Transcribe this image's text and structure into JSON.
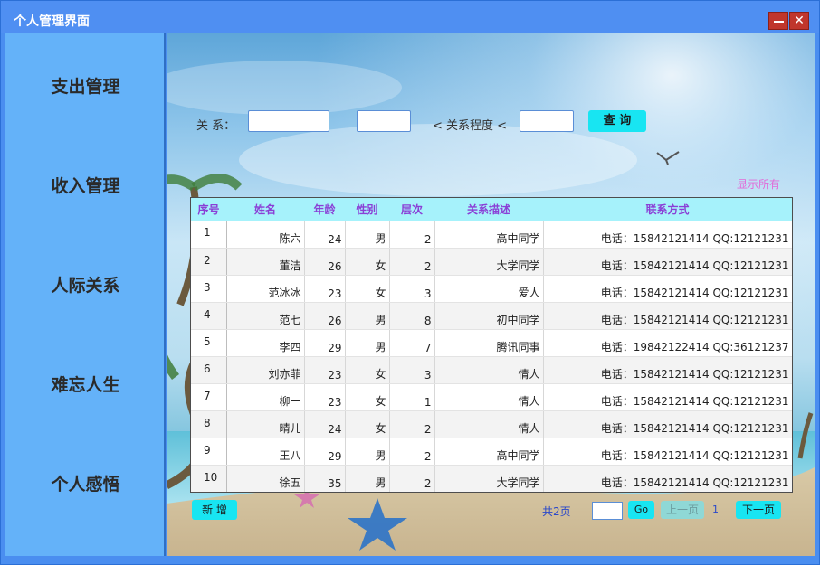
{
  "window": {
    "title": "个人管理界面",
    "minimize_label": "—",
    "close_label": "✕"
  },
  "sidebar": {
    "items": [
      {
        "label": "支出管理"
      },
      {
        "label": "收入管理"
      },
      {
        "label": "人际关系"
      },
      {
        "label": "难忘人生"
      },
      {
        "label": "个人感悟"
      }
    ]
  },
  "search": {
    "relation_label": "关 系：",
    "relation_value": "",
    "second_value": "",
    "degree_label": "< 关系程度 <",
    "degree_value": "",
    "query_label": "查 询",
    "show_all_label": "显示所有"
  },
  "table": {
    "columns": [
      "序号",
      "姓名",
      "年龄",
      "性别",
      "层次",
      "关系描述",
      "联系方式"
    ],
    "rows": [
      [
        "1",
        "陈六",
        "24",
        "男",
        "2",
        "高中同学",
        "电话：15842121414 QQ:12121231"
      ],
      [
        "2",
        "董洁",
        "26",
        "女",
        "2",
        "大学同学",
        "电话：15842121414 QQ:12121231"
      ],
      [
        "3",
        "范冰冰",
        "23",
        "女",
        "3",
        "爱人",
        "电话：15842121414 QQ:12121231"
      ],
      [
        "4",
        "范七",
        "26",
        "男",
        "8",
        "初中同学",
        "电话：15842121414 QQ:12121231"
      ],
      [
        "5",
        "李四",
        "29",
        "男",
        "7",
        "腾讯同事",
        "电话：19842122414 QQ:36121237"
      ],
      [
        "6",
        "刘亦菲",
        "23",
        "女",
        "3",
        "情人",
        "电话：15842121414 QQ:12121231"
      ],
      [
        "7",
        "柳一",
        "23",
        "女",
        "1",
        "情人",
        "电话：15842121414 QQ:12121231"
      ],
      [
        "8",
        "晴儿",
        "24",
        "女",
        "2",
        "情人",
        "电话：15842121414 QQ:12121231"
      ],
      [
        "9",
        "王八",
        "29",
        "男",
        "2",
        "高中同学",
        "电话：15842121414 QQ:12121231"
      ],
      [
        "10",
        "徐五",
        "35",
        "男",
        "2",
        "大学同学",
        "电话：15842121414 QQ:12121231"
      ]
    ]
  },
  "footer": {
    "add_label": "新 增",
    "total_pages": "共2页",
    "page_input_value": "",
    "go_label": "Go",
    "prev_label": "上一页",
    "current_page": "1",
    "next_label": "下一页"
  },
  "colors": {
    "title_bar": "#4f8ff2",
    "sidebar": "#64b2f9",
    "button_accent": "#18e5f2",
    "header_row": "#a6f2fb",
    "header_text": "#8a3fd6",
    "close_button": "#c0362c"
  },
  "icons": {
    "window_minimize": "minimize-icon",
    "window_close": "close-icon"
  }
}
